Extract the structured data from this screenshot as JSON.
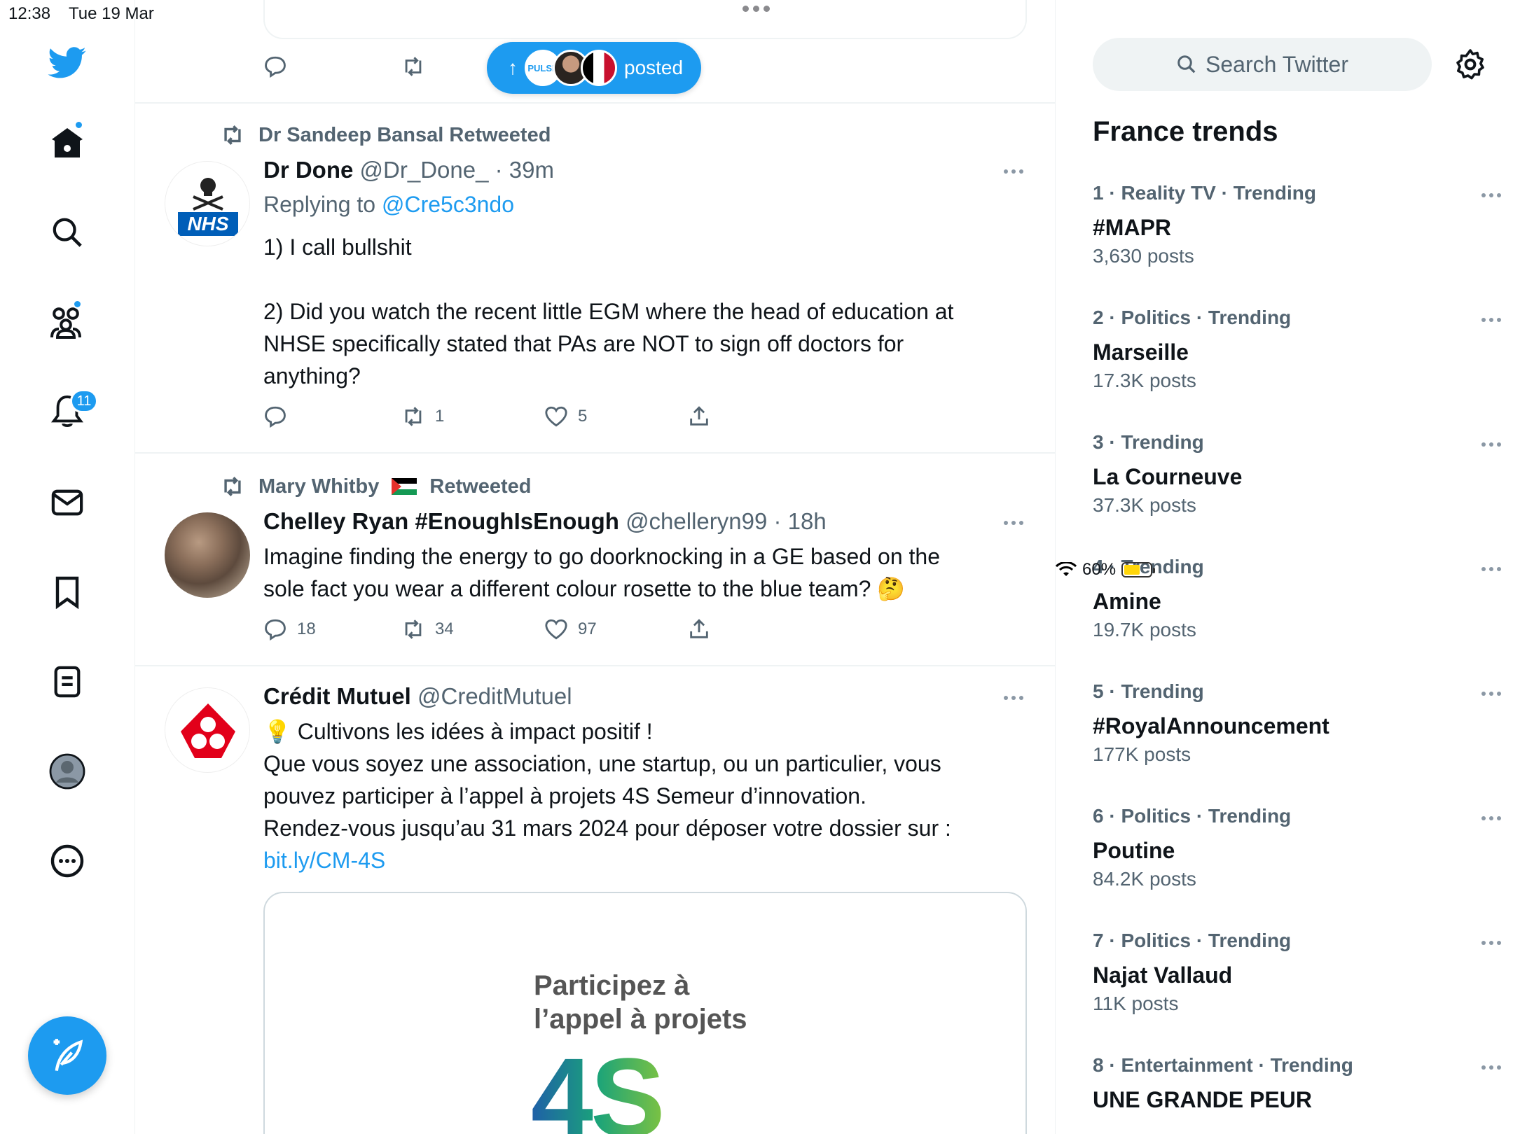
{
  "status_bar": {
    "time": "12:38",
    "date": "Tue 19 Mar",
    "battery": "60%"
  },
  "nav": {
    "notifications_badge": "11"
  },
  "top_partial": {
    "pill_label": "posted"
  },
  "tweets": [
    {
      "retweeted_by": "Dr Sandeep Bansal Retweeted",
      "name": "Dr Done",
      "handle": "@Dr_Done_",
      "time": "· 39m",
      "replying_prefix": "Replying to",
      "replying_handle": "@Cre5c3ndo",
      "text_1": "1) I call bullshit",
      "text_2": "2) Did you watch the recent little EGM where the head of education at NHSE specifically stated that PAs are NOT to sign off doctors for anything?",
      "avatar_text": "NHS",
      "replies": "",
      "retweets": "1",
      "likes": "5"
    },
    {
      "retweeted_by_name": "Mary Whitby",
      "retweeted_by_suffix": "Retweeted",
      "name": "Chelley Ryan #EnoughIsEnough",
      "handle": "@chelleryn99",
      "time": "· 18h",
      "text": "Imagine finding the energy to go doorknocking in a GE based on the sole fact you wear a different colour rosette to the blue team? 🤔",
      "replies": "18",
      "retweets": "34",
      "likes": "97"
    },
    {
      "name": "Crédit Mutuel",
      "handle": "@CreditMutuel",
      "line_1": "💡 Cultivons les idées à impact positif !",
      "line_2": "Que vous soyez une association, une startup, ou un particulier, vous pouvez participer à l’appel à projets 4S Semeur d’innovation.",
      "line_3": "Rendez-vous jusqu’au 31 mars 2024 pour déposer votre dossier sur :",
      "link": "bit.ly/CM-4S",
      "media_line_1": "Participez à",
      "media_line_2": "l’appel à projets",
      "media_big": "4S"
    }
  ],
  "sidebar": {
    "search_placeholder": "Search Twitter",
    "trends_title": "France trends",
    "trends": [
      {
        "context": "1 · Reality TV · Trending",
        "name": "#MAPR",
        "count": "3,630 posts"
      },
      {
        "context": "2 · Politics · Trending",
        "name": "Marseille",
        "count": "17.3K posts"
      },
      {
        "context": "3 · Trending",
        "name": "La Courneuve",
        "count": "37.3K posts"
      },
      {
        "context": "4 · Trending",
        "name": "Amine",
        "count": "19.7K posts"
      },
      {
        "context": "5 · Trending",
        "name": "#RoyalAnnouncement",
        "count": "177K posts"
      },
      {
        "context": "6 · Politics · Trending",
        "name": "Poutine",
        "count": "84.2K posts"
      },
      {
        "context": "7 · Politics · Trending",
        "name": "Najat Vallaud",
        "count": "11K posts"
      },
      {
        "context": "8 · Entertainment · Trending",
        "name": "UNE GRANDE PEUR",
        "count": ""
      }
    ]
  },
  "colors": {
    "accent": "#1d9bf0",
    "text": "#0f1419",
    "secondary": "#536471"
  }
}
